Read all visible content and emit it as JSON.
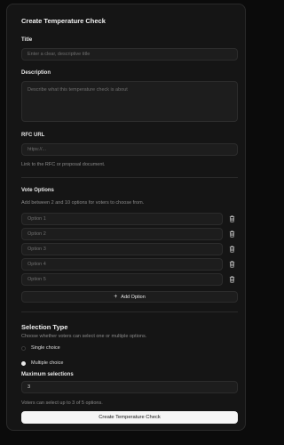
{
  "form": {
    "title": "Create Temperature Check",
    "title_field": {
      "label": "Title",
      "placeholder": "Enter a clear, descriptive title"
    },
    "description_field": {
      "label": "Description",
      "placeholder": "Describe what this temperature check is about"
    },
    "rfc_field": {
      "label": "RFC URL",
      "placeholder": "https://...",
      "help": "Link to the RFC or proposal document."
    },
    "vote_options": {
      "heading": "Vote Options",
      "help": "Add between 2 and 10 options for voters to choose from.",
      "options": [
        {
          "placeholder": "Option 1",
          "remove_icon": "trash-icon"
        },
        {
          "placeholder": "Option 2",
          "remove_icon": "trash-icon"
        },
        {
          "placeholder": "Option 3",
          "remove_icon": "trash-icon"
        },
        {
          "placeholder": "Option 4",
          "remove_icon": "trash-icon"
        },
        {
          "placeholder": "Option 5",
          "remove_icon": "trash-icon"
        }
      ],
      "add_label": "Add Option",
      "add_icon": "plus-icon"
    },
    "selection_type": {
      "heading": "Selection Type",
      "help": "Choose whether voters can select one or multiple options.",
      "choices": [
        {
          "label": "Single choice",
          "selected": false
        },
        {
          "label": "Multiple choice",
          "selected": true
        }
      ],
      "max_label": "Maximum selections",
      "max_value": "3",
      "summary": "Voters can select up to 3 of 5 options."
    },
    "submit_label": "Create Temperature Check"
  }
}
